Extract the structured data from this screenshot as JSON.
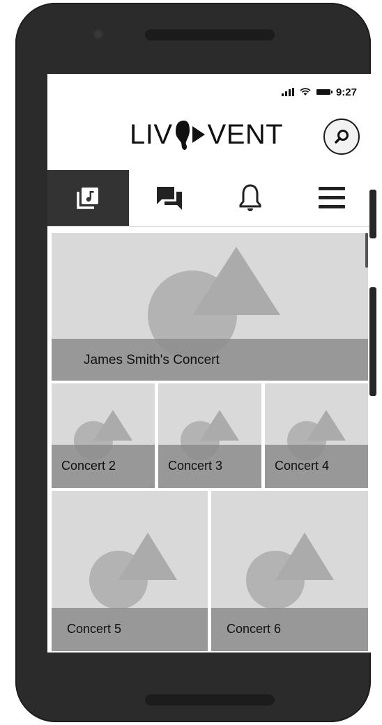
{
  "status_bar": {
    "time": "9:27"
  },
  "header": {
    "logo_left": "LIV",
    "logo_right": "VENT"
  },
  "tabs": [
    {
      "icon": "music-library-icon",
      "active": true
    },
    {
      "icon": "chat-icon",
      "active": false
    },
    {
      "icon": "bell-icon",
      "active": false
    },
    {
      "icon": "menu-icon",
      "active": false
    }
  ],
  "events": {
    "featured": {
      "title": "James Smith's Concert"
    },
    "small": [
      {
        "title": "Concert 2"
      },
      {
        "title": "Concert 3"
      },
      {
        "title": "Concert 4"
      }
    ],
    "medium": [
      {
        "title": "Concert 5"
      },
      {
        "title": "Concert 6"
      }
    ]
  },
  "colors": {
    "active_tab": "#333333",
    "tile_bg": "#d9d9d9",
    "caption_bg": "#8c8c8c",
    "phone_body": "#2b2b2b"
  }
}
